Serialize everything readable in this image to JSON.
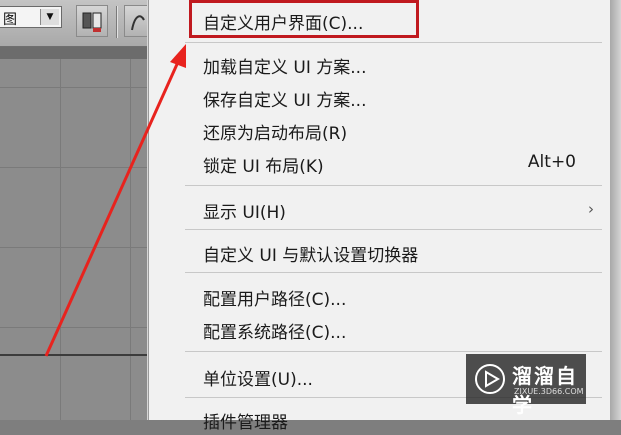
{
  "toolbar": {
    "dropdown_text": "图"
  },
  "menu": {
    "items": [
      {
        "label": "自定义用户界面(C)..."
      },
      {
        "label": "加载自定义 UI 方案..."
      },
      {
        "label": "保存自定义 UI 方案..."
      },
      {
        "label": "还原为启动布局(R)"
      },
      {
        "label": "锁定 UI 布局(K)",
        "shortcut": "Alt+0"
      },
      {
        "label": "显示 UI(H)"
      },
      {
        "label": "自定义 UI 与默认设置切换器"
      },
      {
        "label": "配置用户路径(C)..."
      },
      {
        "label": "配置系统路径(C)..."
      },
      {
        "label": "单位设置(U)..."
      },
      {
        "label": "插件管理器"
      }
    ],
    "highlight_color": "#c0191f"
  },
  "annotation": {
    "arrow_color": "#e8231e"
  },
  "watermark": {
    "title": "溜溜自学",
    "url": "ZIXUE.3D66.COM"
  }
}
